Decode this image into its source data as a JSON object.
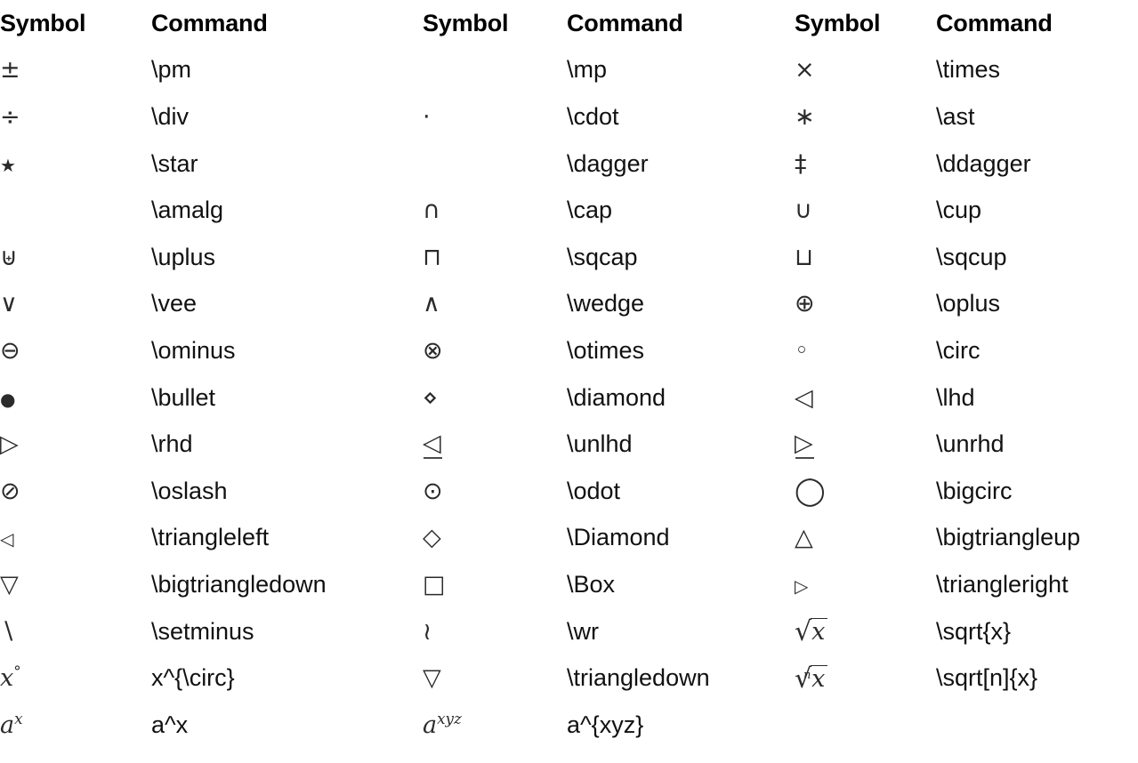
{
  "page": {
    "title": "LaTeX Binary Operators and Symbols Reference Table",
    "background_color": "#ffffff",
    "text_color": "#1a1a1a",
    "symbol_color": "#2b2b2b"
  },
  "headers": {
    "symbol": "Symbol",
    "command": "Command"
  },
  "columns": [
    {
      "symbol_header": "Symbol",
      "command_header": "Command"
    },
    {
      "symbol_header": "Symbol",
      "command_header": "Command"
    },
    {
      "symbol_header": "Symbol",
      "command_header": "Command"
    }
  ],
  "rows": [
    {
      "c1": {
        "symbol": "±",
        "command": "\\pm",
        "icon": "plus-minus-symbol"
      },
      "c2": {
        "symbol": "",
        "command": "\\mp",
        "icon": "minus-plus-symbol-missing"
      },
      "c3": {
        "symbol": "×",
        "command": "\\times",
        "icon": "times-symbol"
      }
    },
    {
      "c1": {
        "symbol": "÷",
        "command": "\\div",
        "icon": "division-symbol"
      },
      "c2": {
        "symbol": "·",
        "command": "\\cdot",
        "icon": "center-dot-symbol"
      },
      "c3": {
        "symbol": "∗",
        "command": "\\ast",
        "icon": "asterisk-operator-symbol"
      }
    },
    {
      "c1": {
        "symbol": "★",
        "command": "\\star",
        "icon": "star-symbol"
      },
      "c2": {
        "symbol": "",
        "command": "\\dagger",
        "icon": "dagger-symbol-missing"
      },
      "c3": {
        "symbol": "‡",
        "command": "\\ddagger",
        "icon": "double-dagger-symbol"
      }
    },
    {
      "c1": {
        "symbol": "",
        "command": "\\amalg",
        "icon": "amalgamation-symbol-missing"
      },
      "c2": {
        "symbol": "∩",
        "command": "\\cap",
        "icon": "intersection-symbol"
      },
      "c3": {
        "symbol": "∪",
        "command": "\\cup",
        "icon": "union-symbol"
      }
    },
    {
      "c1": {
        "symbol": "⊎",
        "command": "\\uplus",
        "icon": "multiset-union-symbol"
      },
      "c2": {
        "symbol": "⊓",
        "command": "\\sqcap",
        "icon": "square-cap-symbol"
      },
      "c3": {
        "symbol": "⊔",
        "command": "\\sqcup",
        "icon": "square-cup-symbol"
      }
    },
    {
      "c1": {
        "symbol": "∨",
        "command": "\\vee",
        "icon": "logical-or-symbol"
      },
      "c2": {
        "symbol": "∧",
        "command": "\\wedge",
        "icon": "logical-and-symbol"
      },
      "c3": {
        "symbol": "⊕",
        "command": "\\oplus",
        "icon": "circled-plus-symbol"
      }
    },
    {
      "c1": {
        "symbol": "⊖",
        "command": "\\ominus",
        "icon": "circled-minus-symbol"
      },
      "c2": {
        "symbol": "⊗",
        "command": "\\otimes",
        "icon": "circled-times-symbol"
      },
      "c3": {
        "symbol": "◦",
        "command": "\\circ",
        "icon": "small-circle-symbol"
      }
    },
    {
      "c1": {
        "symbol": "●",
        "command": "\\bullet",
        "icon": "bullet-symbol"
      },
      "c2": {
        "symbol": "⋄",
        "command": "\\diamond",
        "icon": "small-diamond-symbol"
      },
      "c3": {
        "symbol": "◁",
        "command": "\\lhd",
        "icon": "left-triangle-symbol"
      }
    },
    {
      "c1": {
        "symbol": "▷",
        "command": "\\rhd",
        "icon": "right-triangle-symbol"
      },
      "c2": {
        "symbol": "⊴",
        "command": "\\unlhd",
        "icon": "underlined-left-triangle-symbol"
      },
      "c3": {
        "symbol": "⊵",
        "command": "\\unrhd",
        "icon": "underlined-right-triangle-symbol"
      }
    },
    {
      "c1": {
        "symbol": "⊘",
        "command": "\\oslash",
        "icon": "circled-slash-symbol"
      },
      "c2": {
        "symbol": "⊙",
        "command": "\\odot",
        "icon": "circled-dot-symbol"
      },
      "c3": {
        "symbol": "◯",
        "command": "\\bigcirc",
        "icon": "big-circle-symbol"
      }
    },
    {
      "c1": {
        "symbol": "◁",
        "command": "\\triangleleft",
        "icon": "triangle-left-symbol"
      },
      "c2": {
        "symbol": "◇",
        "command": "\\Diamond",
        "icon": "diamond-symbol"
      },
      "c3": {
        "symbol": "△",
        "command": "\\bigtriangleup",
        "icon": "big-triangle-up-symbol"
      }
    },
    {
      "c1": {
        "symbol": "▽",
        "command": "\\bigtriangledown",
        "icon": "big-triangle-down-symbol"
      },
      "c2": {
        "symbol": "□",
        "command": "\\Box",
        "icon": "box-symbol"
      },
      "c3": {
        "symbol": "▷",
        "command": "\\triangleright",
        "icon": "triangle-right-symbol"
      }
    },
    {
      "c1": {
        "symbol": "∖",
        "command": "\\setminus",
        "icon": "set-minus-symbol"
      },
      "c2": {
        "symbol": "≀",
        "command": "\\wr",
        "icon": "wreath-product-symbol"
      },
      "c3": {
        "symbol": "√x",
        "command": "\\sqrt{x}",
        "icon": "square-root-symbol"
      }
    },
    {
      "c1": {
        "symbol": "x°",
        "command": "x^{\\circ}",
        "icon": "x-degree-symbol"
      },
      "c2": {
        "symbol": "▽",
        "command": "\\triangledown",
        "icon": "triangle-down-symbol"
      },
      "c3": {
        "symbol": "ⁿ√x",
        "command": "\\sqrt[n]{x}",
        "icon": "nth-root-symbol"
      }
    },
    {
      "c1": {
        "symbol": "aˣ",
        "command": "a^x",
        "icon": "a-superscript-x-symbol"
      },
      "c2": {
        "symbol": "aˣʸᶻ",
        "command": "a^{xyz}",
        "icon": "a-superscript-xyz-symbol"
      },
      "c3": {
        "symbol": "",
        "command": "",
        "icon": "empty-cell"
      }
    }
  ]
}
